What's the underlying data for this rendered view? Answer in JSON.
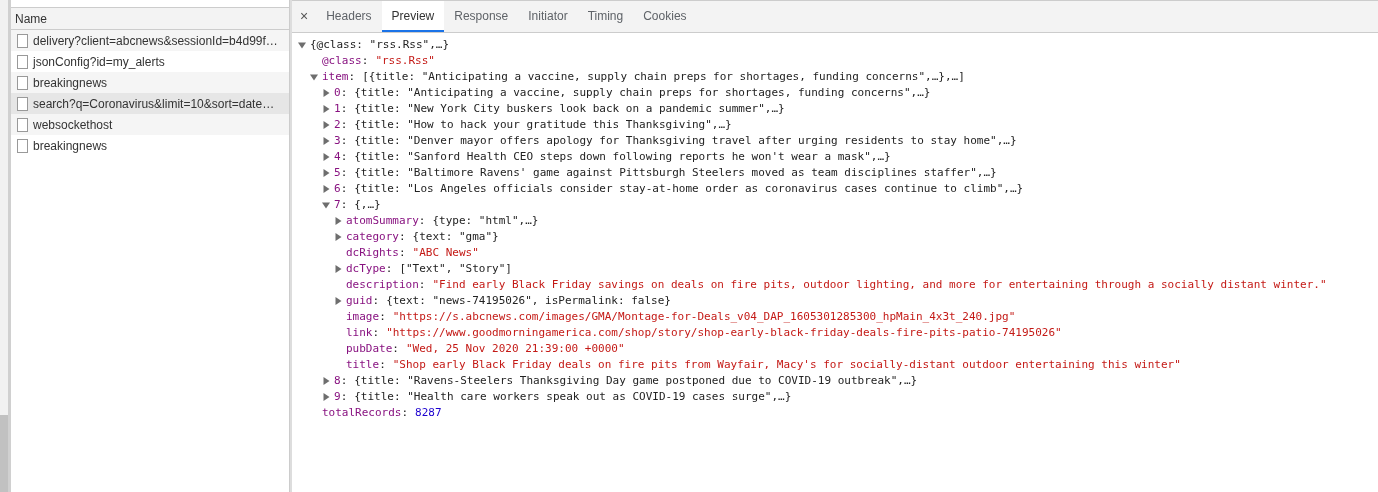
{
  "requests": {
    "column_header": "Name",
    "rows": [
      {
        "name": "delivery?client=abcnews&sessionId=b4d99f…",
        "selected": false
      },
      {
        "name": "jsonConfig?id=my_alerts",
        "selected": false
      },
      {
        "name": "breakingnews",
        "selected": false
      },
      {
        "name": "search?q=Coronavirus&limit=10&sort=date…",
        "selected": true
      },
      {
        "name": "websockethost",
        "selected": false
      },
      {
        "name": "breakingnews",
        "selected": false
      }
    ]
  },
  "detail": {
    "close": "×",
    "key_separator": ":",
    "tabs": [
      {
        "label": "Headers",
        "selected": false
      },
      {
        "label": "Preview",
        "selected": true
      },
      {
        "label": "Response",
        "selected": false
      },
      {
        "label": "Initiator",
        "selected": false
      },
      {
        "label": "Timing",
        "selected": false
      },
      {
        "label": "Cookies",
        "selected": false
      }
    ],
    "preview_tree": [
      {
        "value": "{@class: \"rss.Rss\",…}",
        "kind": "object",
        "expanded": true,
        "children": [
          {
            "key": "@class",
            "value": "\"rss.Rss\"",
            "kind": "string"
          },
          {
            "key": "item",
            "value": "[{title: \"Anticipating a vaccine, supply chain preps for shortages, funding concerns\",…},…]",
            "kind": "object",
            "expanded": true,
            "children": [
              {
                "key": "0",
                "value": "{title: \"Anticipating a vaccine, supply chain preps for shortages, funding concerns\",…}",
                "kind": "object",
                "expanded": false
              },
              {
                "key": "1",
                "value": "{title: \"New York City buskers look back on a pandemic summer\",…}",
                "kind": "object",
                "expanded": false
              },
              {
                "key": "2",
                "value": "{title: \"How to hack your gratitude this Thanksgiving\",…}",
                "kind": "object",
                "expanded": false
              },
              {
                "key": "3",
                "value": "{title: \"Denver mayor offers apology for Thanksgiving travel after urging residents to stay home\",…}",
                "kind": "object",
                "expanded": false
              },
              {
                "key": "4",
                "value": "{title: \"Sanford Health CEO steps down following reports he won't wear a mask\",…}",
                "kind": "object",
                "expanded": false
              },
              {
                "key": "5",
                "value": "{title: \"Baltimore Ravens' game against Pittsburgh Steelers moved as team disciplines staffer\",…}",
                "kind": "object",
                "expanded": false
              },
              {
                "key": "6",
                "value": "{title: \"Los Angeles officials consider stay-at-home order as coronavirus cases continue to climb\",…}",
                "kind": "object",
                "expanded": false
              },
              {
                "key": "7",
                "value": "{,…}",
                "kind": "object",
                "expanded": true,
                "children": [
                  {
                    "key": "atomSummary",
                    "value": "{type: \"html\",…}",
                    "kind": "object",
                    "expanded": false
                  },
                  {
                    "key": "category",
                    "value": "{text: \"gma\"}",
                    "kind": "object",
                    "expanded": false
                  },
                  {
                    "key": "dcRights",
                    "value": "\"ABC News\"",
                    "kind": "string"
                  },
                  {
                    "key": "dcType",
                    "value": "[\"Text\", \"Story\"]",
                    "kind": "object",
                    "expanded": false
                  },
                  {
                    "key": "description",
                    "value": "\"Find early Black Friday savings on deals on fire pits, outdoor lighting, and more for entertaining through a socially distant winter.\"",
                    "kind": "string"
                  },
                  {
                    "key": "guid",
                    "value": "{text: \"news-74195026\", isPermalink: false}",
                    "kind": "object",
                    "expanded": false
                  },
                  {
                    "key": "image",
                    "value": "\"https://s.abcnews.com/images/GMA/Montage-for-Deals_v04_DAP_1605301285300_hpMain_4x3t_240.jpg\"",
                    "kind": "string"
                  },
                  {
                    "key": "link",
                    "value": "\"https://www.goodmorningamerica.com/shop/story/shop-early-black-friday-deals-fire-pits-patio-74195026\"",
                    "kind": "string"
                  },
                  {
                    "key": "pubDate",
                    "value": "\"Wed, 25 Nov 2020 21:39:00 +0000\"",
                    "kind": "string"
                  },
                  {
                    "key": "title",
                    "value": "\"Shop early Black Friday deals on fire pits from Wayfair, Macy's for socially-distant outdoor entertaining this winter\"",
                    "kind": "string"
                  }
                ]
              },
              {
                "key": "8",
                "value": "{title: \"Ravens-Steelers Thanksgiving Day game postponed due to COVID-19 outbreak\",…}",
                "kind": "object",
                "expanded": false
              },
              {
                "key": "9",
                "value": "{title: \"Health care workers speak out as COVID-19 cases surge\",…}",
                "kind": "object",
                "expanded": false
              }
            ]
          },
          {
            "key": "totalRecords",
            "value": "8287",
            "kind": "number"
          }
        ]
      }
    ]
  }
}
